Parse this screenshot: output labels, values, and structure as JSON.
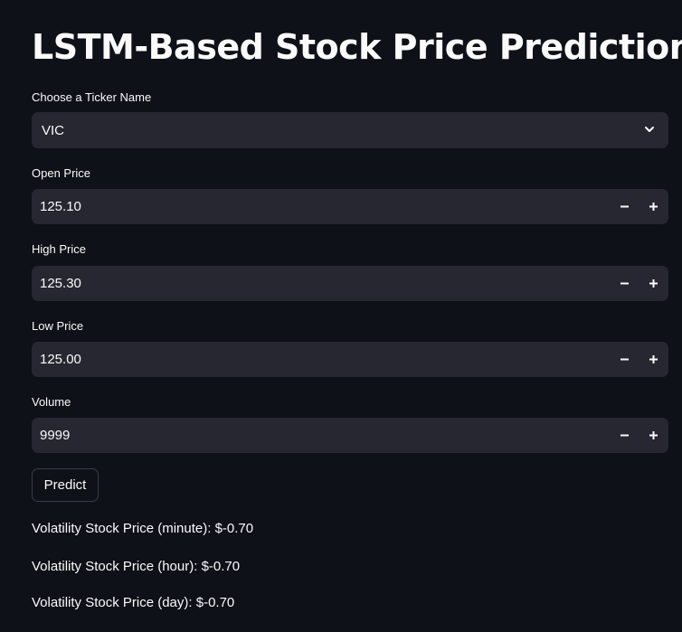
{
  "page": {
    "title": "LSTM-Based Stock Price Prediction"
  },
  "ticker": {
    "label": "Choose a Ticker Name",
    "selected": "VIC"
  },
  "fields": {
    "open": {
      "label": "Open Price",
      "value": "125.10"
    },
    "high": {
      "label": "High Price",
      "value": "125.30"
    },
    "low": {
      "label": "Low Price",
      "value": "125.00"
    },
    "volume": {
      "label": "Volume",
      "value": "9999"
    }
  },
  "stepper": {
    "minus": "−",
    "plus": "+"
  },
  "predict_button": {
    "label": "Predict"
  },
  "results": {
    "minute": "Volatility Stock Price (minute): $-0.70",
    "hour": "Volatility Stock Price (hour): $-0.70",
    "day": "Volatility Stock Price (day): $-0.70"
  },
  "icons": {
    "dropdown": "chevron-down-icon",
    "decrement": "minus-icon",
    "increment": "plus-icon"
  },
  "colors": {
    "background": "#0e1117",
    "input_background": "#262730",
    "text": "#fafafa",
    "button_border": "#3a3c46"
  }
}
